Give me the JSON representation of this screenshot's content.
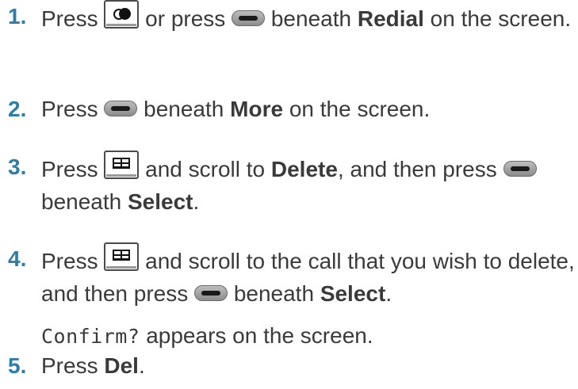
{
  "steps": [
    {
      "number": "1.",
      "t1": "Press",
      "t2": "or press",
      "t3": "beneath",
      "b1": "Redial",
      "t4": "on the screen."
    },
    {
      "number": "2.",
      "t1": "Press",
      "t2": "beneath",
      "b1": "More",
      "t3": "on the screen."
    },
    {
      "number": "3.",
      "t1": "Press",
      "t2": "and scroll to",
      "b1": "Delete",
      "t3": ", and then press",
      "t4": "beneath",
      "b2": "Select",
      "t5": "."
    },
    {
      "number": "4.",
      "t1": "Press",
      "t2": "and scroll to the call that you wish to delete, and then press",
      "t3": "beneath",
      "b1": "Select",
      "t4": ".",
      "note_code": "Confirm?",
      "note_text": "appears on the screen."
    },
    {
      "number": "5.",
      "t1": "Press",
      "b1": "Del",
      "t2": "."
    }
  ],
  "icons": {
    "redial_key": "redial-key-icon",
    "soft_key": "soft-key-icon",
    "phonebook_key": "phonebook-key-icon"
  }
}
